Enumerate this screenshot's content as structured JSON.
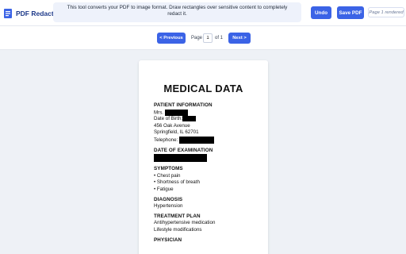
{
  "app": {
    "title": "PDF Redactor",
    "icon": "document-icon"
  },
  "info_message": "This tool converts your PDF to image format. Draw rectangles over sensitive content to completely redact it.",
  "toolbar": {
    "undo_label": "Undo",
    "save_label": "Save PDF",
    "status": "Page 1 rendered"
  },
  "pagination": {
    "prev_label": "< Previous",
    "page_label": "Page",
    "current_page": "1",
    "of_label": "of 1",
    "next_label": "Next >"
  },
  "colors": {
    "accent": "#3b63e6",
    "brand": "#1e3a8a",
    "background": "#eef1f6",
    "info_bg": "#eef2fb"
  },
  "document": {
    "title": "MEDICAL DATA",
    "patient_heading": "PATIENT INFORMATION",
    "patient_name_prefix": "Mrs.",
    "dob_prefix": "Date of Birth:",
    "address_line1": "456 Oak Avenue",
    "address_line2": "Springfield, IL 62701",
    "telephone_prefix": "Telephone:",
    "exam_heading": "DATE OF EXAMINATION",
    "symptoms_heading": "SYMPTOMS",
    "symptoms": [
      "• Chest pain",
      "• Shortness of breath",
      "• Fatigue"
    ],
    "diagnosis_heading": "DIAGNOSIS",
    "diagnosis": "Hypertension",
    "treatment_heading": "TREATMENT PLAN",
    "treatment": [
      "Antihypertensive medication",
      "Lifestyle modifications"
    ],
    "physician_heading": "PHYSICIAN"
  }
}
